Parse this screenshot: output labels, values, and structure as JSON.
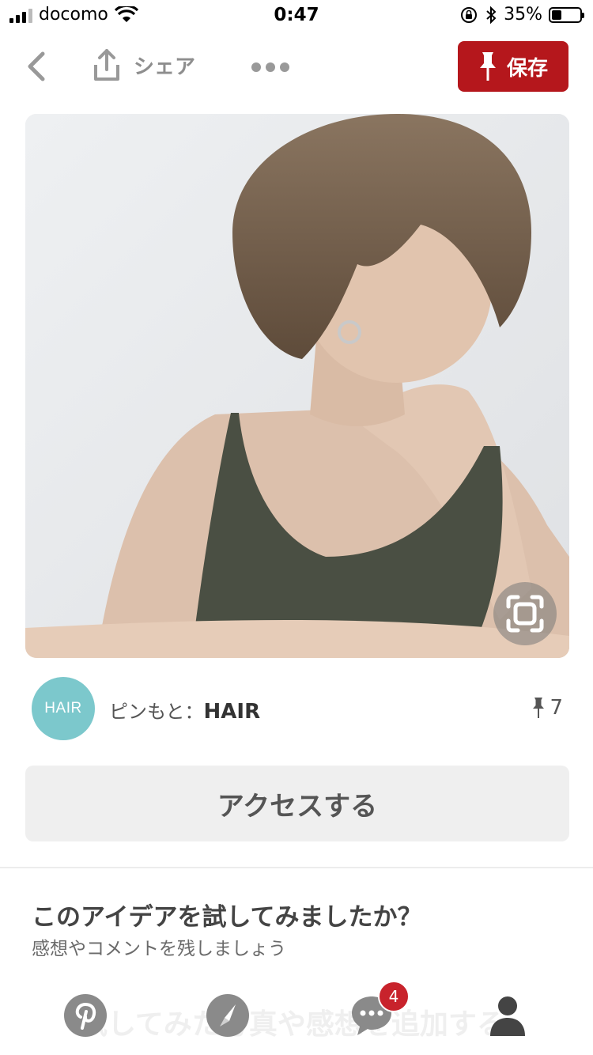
{
  "status_bar": {
    "carrier": "docomo",
    "time": "0:47",
    "battery_percent": "35%",
    "battery_level": 0.35
  },
  "toolbar": {
    "share_label": "シェア",
    "save_label": "保存"
  },
  "pin_source": {
    "avatar_text": "HAIR",
    "prefix": "ピンもと：",
    "name": "HAIR",
    "pin_count": "7"
  },
  "access_button": {
    "label": "アクセスする"
  },
  "tried": {
    "title": "このアイデアを試してみましたか？",
    "subtitle": "感想やコメントを残しましょう",
    "ghost_text": "試してみた写真や感想を追加する"
  },
  "bottom_nav": {
    "messages_badge": "4"
  },
  "colors": {
    "accent": "#b5171c",
    "avatar": "#7cc8cc",
    "badge": "#c8232c"
  }
}
